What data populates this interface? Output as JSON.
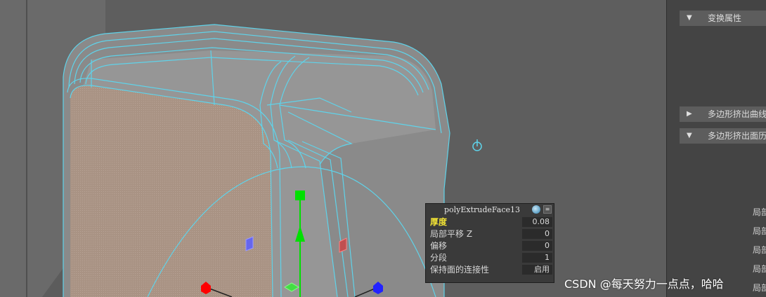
{
  "attribute_editor": {
    "sections": [
      {
        "label": "变换属性",
        "expanded": true
      },
      {
        "label": "多边形挤出曲线",
        "expanded": false
      },
      {
        "label": "多边形挤出面历",
        "expanded": true
      }
    ],
    "side_labels": [
      "局部",
      "局部",
      "局部",
      "局部",
      "局部"
    ]
  },
  "hud": {
    "node_name": "polyExtrudeFace13",
    "rows": [
      {
        "label": "厚度",
        "value": "0.08",
        "highlighted": true
      },
      {
        "label": "局部平移 Z",
        "value": "0",
        "highlighted": false
      },
      {
        "label": "偏移",
        "value": "0",
        "highlighted": false
      },
      {
        "label": "分段",
        "value": "1",
        "highlighted": false
      },
      {
        "label": "保持面的连接性",
        "value": "启用",
        "highlighted": false
      }
    ]
  },
  "watermark": "CSDN @每天努力一点点，哈哈",
  "colors": {
    "wireframe": "#5fd3ea",
    "face_selected": "#a99384",
    "mesh_gray": "#8c8c8c",
    "highlight_label": "#f2e335",
    "manip_green": "#00e000",
    "manip_red": "#ff0000",
    "manip_blue": "#2222ff"
  },
  "icons": [
    "pivot-icon",
    "hud-options-icon",
    "hud-menu-icon"
  ]
}
